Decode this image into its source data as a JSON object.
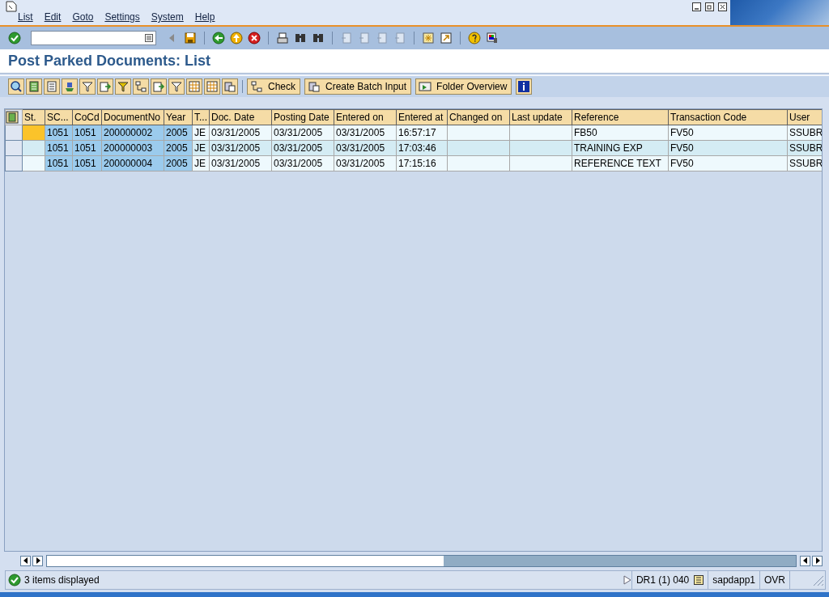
{
  "menu": [
    {
      "label": "List"
    },
    {
      "label": "Edit"
    },
    {
      "label": "Goto"
    },
    {
      "label": "Settings"
    },
    {
      "label": "System"
    },
    {
      "label": "Help"
    }
  ],
  "title": "Post Parked Documents: List",
  "app_toolbar": {
    "buttons": [
      {
        "label": "Check"
      },
      {
        "label": "Create Batch Input"
      },
      {
        "label": "Folder Overview"
      }
    ]
  },
  "table": {
    "columns": [
      {
        "label": "St.",
        "kind": "status",
        "key": false
      },
      {
        "label": "SC...",
        "kind": "text",
        "key": true
      },
      {
        "label": "CoCd",
        "kind": "text",
        "key": true
      },
      {
        "label": "DocumentNo",
        "kind": "text",
        "key": true
      },
      {
        "label": "Year",
        "kind": "text",
        "key": true
      },
      {
        "label": "T...",
        "kind": "text",
        "key": false
      },
      {
        "label": "Doc. Date",
        "kind": "text",
        "key": false
      },
      {
        "label": "Posting Date",
        "kind": "text",
        "key": false
      },
      {
        "label": "Entered on",
        "kind": "text",
        "key": false
      },
      {
        "label": "Entered at",
        "kind": "text",
        "key": false
      },
      {
        "label": "Changed on",
        "kind": "text",
        "key": false
      },
      {
        "label": "Last update",
        "kind": "text",
        "key": false
      },
      {
        "label": "Reference",
        "kind": "text",
        "key": false
      },
      {
        "label": "Transaction Code",
        "kind": "text",
        "key": false
      },
      {
        "label": "User",
        "kind": "text",
        "key": false
      }
    ],
    "rows": [
      {
        "focused": true,
        "cells": [
          null,
          "1051",
          "1051",
          "200000002",
          "2005",
          "JE",
          "03/31/2005",
          "03/31/2005",
          "03/31/2005",
          "16:57:17",
          null,
          null,
          "FB50",
          "FV50",
          "SSUBR"
        ]
      },
      {
        "focused": false,
        "cells": [
          null,
          "1051",
          "1051",
          "200000003",
          "2005",
          "JE",
          "03/31/2005",
          "03/31/2005",
          "03/31/2005",
          "17:03:46",
          null,
          null,
          "TRAINING EXP",
          "FV50",
          "SSUBR"
        ]
      },
      {
        "focused": false,
        "cells": [
          null,
          "1051",
          "1051",
          "200000004",
          "2005",
          "JE",
          "03/31/2005",
          "03/31/2005",
          "03/31/2005",
          "17:15:16",
          null,
          null,
          "REFERENCE TEXT",
          "FV50",
          "SSUBR"
        ]
      }
    ]
  },
  "status_bar": {
    "message": "3 items displayed",
    "system": "DR1 (1) 040",
    "server": "sapdapp1",
    "mode": "OVR"
  }
}
